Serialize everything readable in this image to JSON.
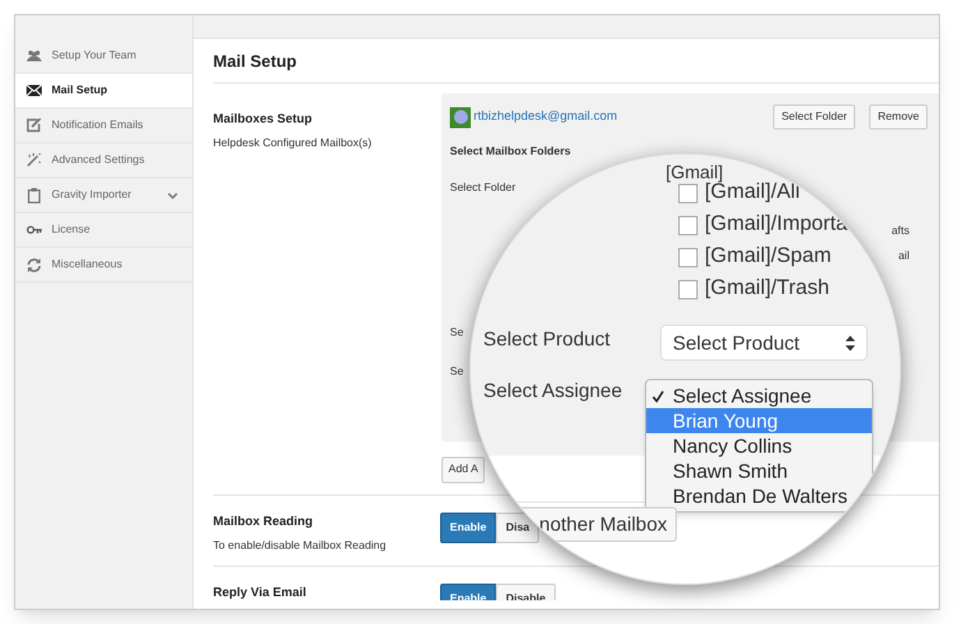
{
  "sidebar": {
    "items": [
      {
        "label": "Setup Your Team",
        "selected": false,
        "expandable": false
      },
      {
        "label": "Mail Setup",
        "selected": true,
        "expandable": false
      },
      {
        "label": "Notification Emails",
        "selected": false,
        "expandable": false
      },
      {
        "label": "Advanced Settings",
        "selected": false,
        "expandable": false
      },
      {
        "label": "Gravity Importer",
        "selected": false,
        "expandable": true
      },
      {
        "label": "License",
        "selected": false,
        "expandable": false
      },
      {
        "label": "Miscellaneous",
        "selected": false,
        "expandable": false
      }
    ]
  },
  "page_title": "Mail Setup",
  "mailboxes": {
    "title": "Mailboxes Setup",
    "subtitle": "Helpdesk Configured Mailbox(s)",
    "email": "rtbizhelpdesk@gmail.com",
    "buttons": [
      "Select Folder",
      "Remove"
    ],
    "folders_heading": "Select Mailbox Folders",
    "folder_label": "Select Folder",
    "side_fragments": [
      "afts",
      "ail"
    ],
    "row_labels": [
      "Se",
      "Se"
    ],
    "add_button": "Add A"
  },
  "settings": [
    {
      "title": "Mailbox Reading",
      "subtitle": "To enable/disable Mailbox Reading",
      "options": [
        {
          "label": "Enable",
          "selected": true
        },
        {
          "label": "Disa",
          "selected": false
        }
      ]
    },
    {
      "title": "Reply Via Email",
      "options": [
        {
          "label": "Enable",
          "selected": true
        },
        {
          "label": "Disable",
          "selected": false
        }
      ]
    }
  ],
  "magnifier": {
    "folder_group": "[Gmail]",
    "folders": [
      {
        "label": "[Gmail]/All",
        "checked": false
      },
      {
        "label": "[Gmail]/Importa",
        "checked": false
      },
      {
        "label": "[Gmail]/Spam",
        "checked": false
      },
      {
        "label": "[Gmail]/Trash",
        "checked": false
      }
    ],
    "product": {
      "label": "Select Product",
      "value": "Select Product"
    },
    "assignee": {
      "label": "Select Assignee",
      "options": [
        {
          "label": "Select Assignee",
          "checked": true,
          "selected": false
        },
        {
          "label": "Brian Young",
          "checked": false,
          "selected": true
        },
        {
          "label": "Nancy Collins",
          "checked": false,
          "selected": false
        },
        {
          "label": "Shawn Smith",
          "checked": false,
          "selected": false
        },
        {
          "label": "Brendan De Walters",
          "checked": false,
          "selected": false
        }
      ]
    },
    "add_button": "nother Mailbox"
  }
}
